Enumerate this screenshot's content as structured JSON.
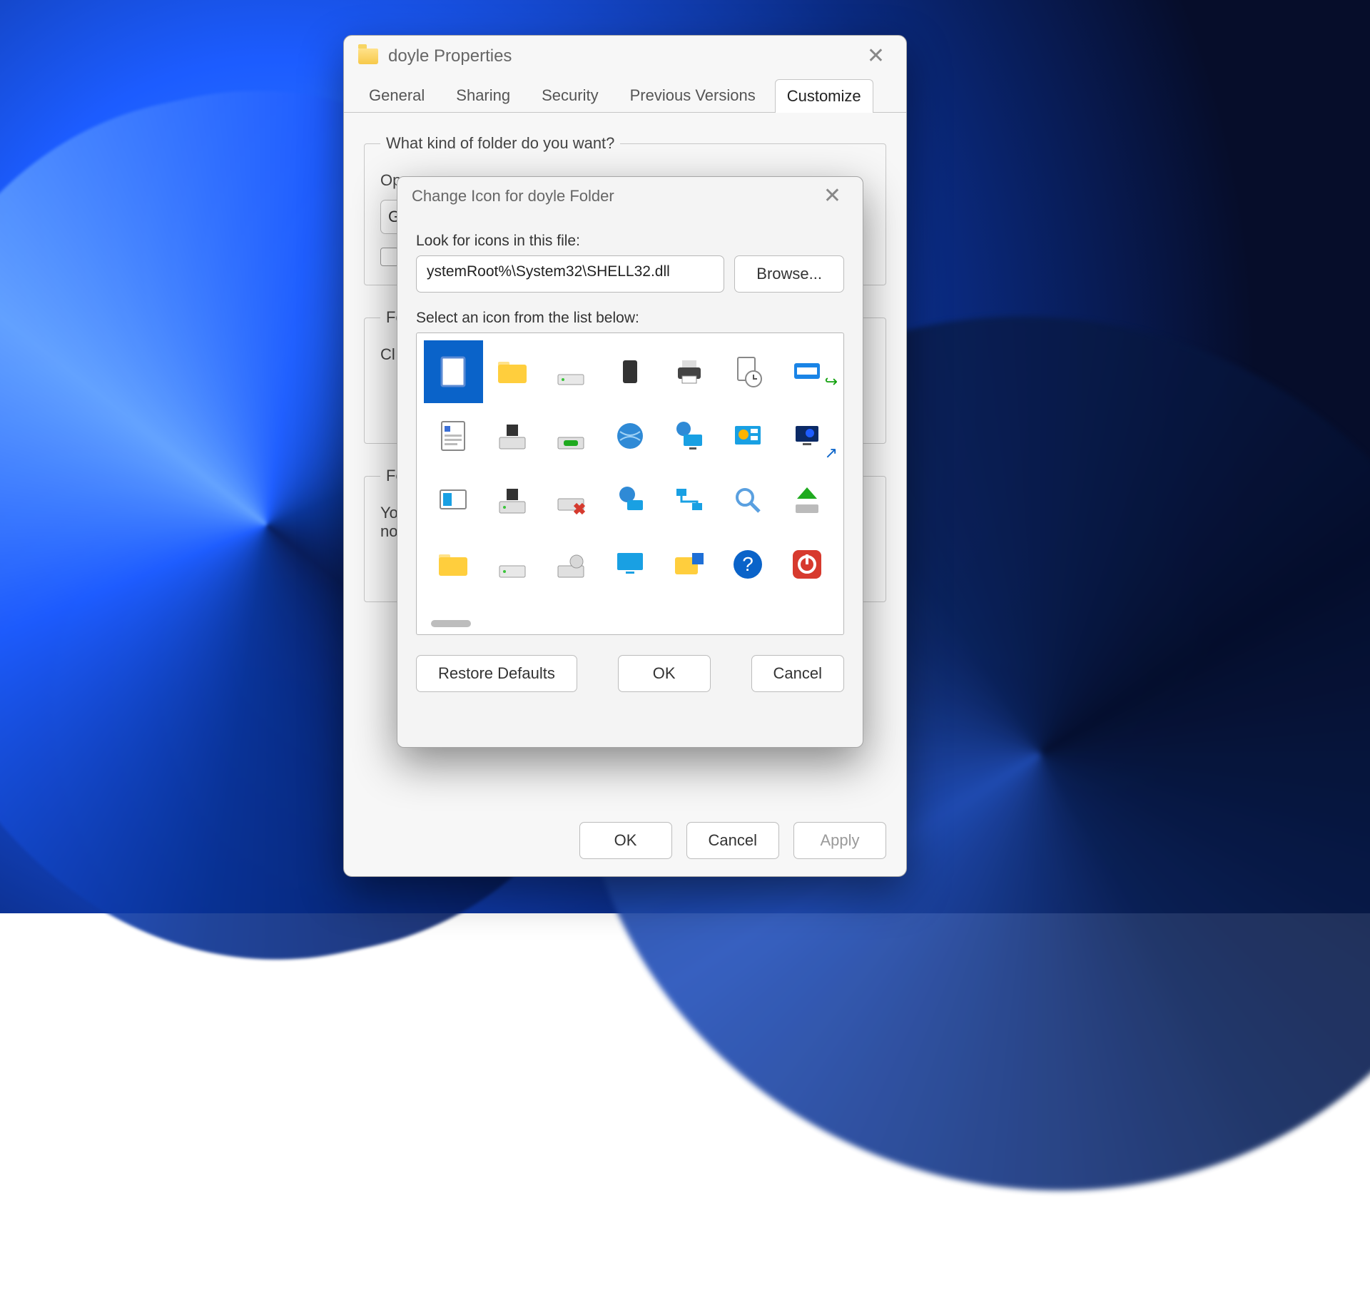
{
  "properties": {
    "title": "doyle Properties",
    "tabs": [
      "General",
      "Sharing",
      "Security",
      "Previous Versions",
      "Customize"
    ],
    "active_tab": 4,
    "section_kind": {
      "legend": "What kind of folder do you want?",
      "optimize_label_trunc": "Op",
      "general_trunc": "G"
    },
    "section_folder": {
      "legend_trunc": "Fo",
      "choose_trunc": "Cl"
    },
    "section_icon": {
      "legend_trunc": "Fo",
      "you_trunc": "Yo",
      "no_trunc": "no"
    },
    "buttons": {
      "ok": "OK",
      "cancel": "Cancel",
      "apply": "Apply"
    }
  },
  "change_icon": {
    "title": "Change Icon for doyle Folder",
    "look_label": "Look for icons in this file:",
    "path_value": "ystemRoot%\\System32\\SHELL32.dll",
    "browse": "Browse...",
    "select_label": "Select an icon from the list below:",
    "icons": [
      "blank-document",
      "folder",
      "hard-drive",
      "chip",
      "printer",
      "document-clock",
      "run-dialog",
      "text-document",
      "floppy-drive",
      "removable-drive",
      "globe",
      "network-monitor",
      "control-panel",
      "screensaver",
      "settings-window",
      "save-disk",
      "drive-error",
      "network-globe",
      "network",
      "search-magnifier",
      "eject-drive",
      "folder-open",
      "hard-drive-2",
      "optical-drive",
      "monitor",
      "folder-options",
      "help-circle",
      "power-off"
    ],
    "selected_index": 0,
    "buttons": {
      "restore": "Restore Defaults",
      "ok": "OK",
      "cancel": "Cancel"
    }
  }
}
